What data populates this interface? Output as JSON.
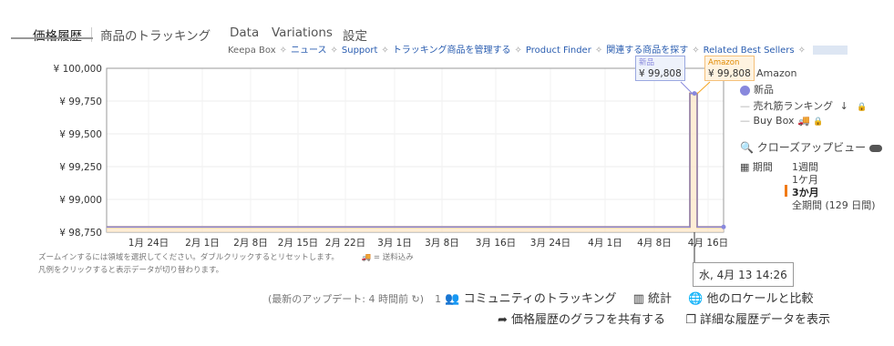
{
  "tabs": {
    "price_history": "価格履歴",
    "tracking": "商品のトラッキング",
    "data": "Data",
    "variations": "Variations",
    "settings": "設定"
  },
  "nav": {
    "keepa_box": "Keepa Box",
    "news": "ニュース",
    "support": "Support",
    "manage_tracking": "トラッキング商品を管理する",
    "product_finder": "Product Finder",
    "related": "関連する商品を探す",
    "related_best_sellers": "Related Best Sellers"
  },
  "chart_data": {
    "type": "line",
    "ylim": [
      98750,
      100000
    ],
    "y_ticks": [
      "¥ 100,000",
      "¥ 99,750",
      "¥ 99,500",
      "¥ 99,250",
      "¥ 99,000",
      "¥ 98,750"
    ],
    "x_ticks": [
      "1月 24日",
      "2月 1日",
      "2月 8日",
      "2月 15日",
      "2月 22日",
      "3月 1日",
      "3月 8日",
      "3月 16日",
      "3月 24日",
      "4月 1日",
      "4月 8日",
      "4月 16日"
    ],
    "series": [
      {
        "name": "Amazon",
        "color": "#f5a623",
        "values": [
          98790,
          98790,
          99808,
          99808,
          98790,
          98790
        ]
      },
      {
        "name": "新品",
        "color": "#8888dd",
        "values": [
          98790,
          98790,
          99808,
          99808,
          98790,
          98790
        ]
      }
    ],
    "fill_color": "#fde5c4",
    "grid": true
  },
  "tooltips": {
    "new_label": "新品",
    "new_value": "¥ 99,808",
    "amazon_label": "Amazon",
    "amazon_value": "¥ 99,808",
    "date": "水, 4月 13 14:26"
  },
  "hints": {
    "line1": "ズームインするには領域を選択してください。ダブルクリックするとリセットします。",
    "shipping": "= 送料込み",
    "line2": "凡例をクリックすると表示データが切り替わります。"
  },
  "legend": {
    "amazon": "Amazon",
    "new": "新品",
    "sales_rank": "売れ筋ランキング",
    "buy_box": "Buy Box",
    "closeup": "クローズアップビュー",
    "period": "期間",
    "ranges": [
      "1週間",
      "1ケ月",
      "3か月",
      "全期間 (129 日間)"
    ],
    "selected_range": "3か月"
  },
  "footer": {
    "last_update": "(最新のアップデート: 4 時間前",
    "community_count": "1",
    "community": "コミュニティのトラッキング",
    "stats": "統計",
    "compare": "他のロケールと比較",
    "share": "価格履歴のグラフを共有する",
    "detail": "詳細な履歴データを表示"
  }
}
